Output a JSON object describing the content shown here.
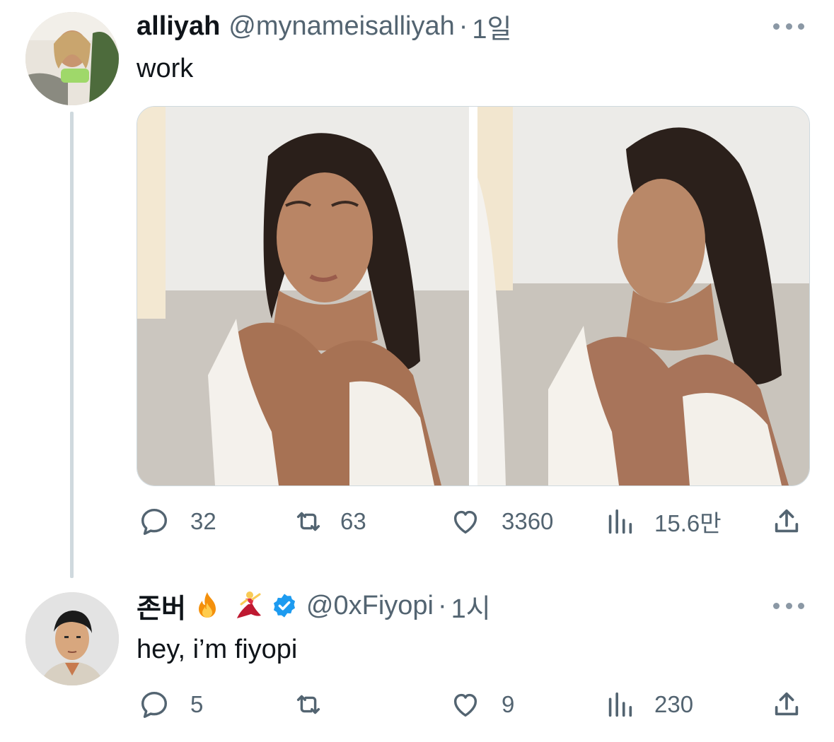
{
  "tweets": [
    {
      "display_name": "alliyah",
      "handle": "@mynameisalliyah",
      "separator": "·",
      "time": "1일",
      "text": "work",
      "avatar": "profile-photo-woman",
      "media_count": 2,
      "actions": {
        "replies": "32",
        "retweets": "63",
        "likes": "3360",
        "views": "15.6만"
      }
    },
    {
      "display_name": "존버",
      "badges": [
        "fire-emoji",
        "dancer-emoji",
        "verified-badge"
      ],
      "handle": "@0xFiyopi",
      "separator": "·",
      "time": "1시",
      "text": "hey, i’m fiyopi",
      "avatar": "profile-photo-man",
      "actions": {
        "replies": "5",
        "retweets": "",
        "likes": "9",
        "views": "230"
      }
    }
  ],
  "colors": {
    "text": "#0f1419",
    "secondary": "#536471",
    "verified": "#1d9bf0",
    "thread_line": "#cfd9de"
  }
}
